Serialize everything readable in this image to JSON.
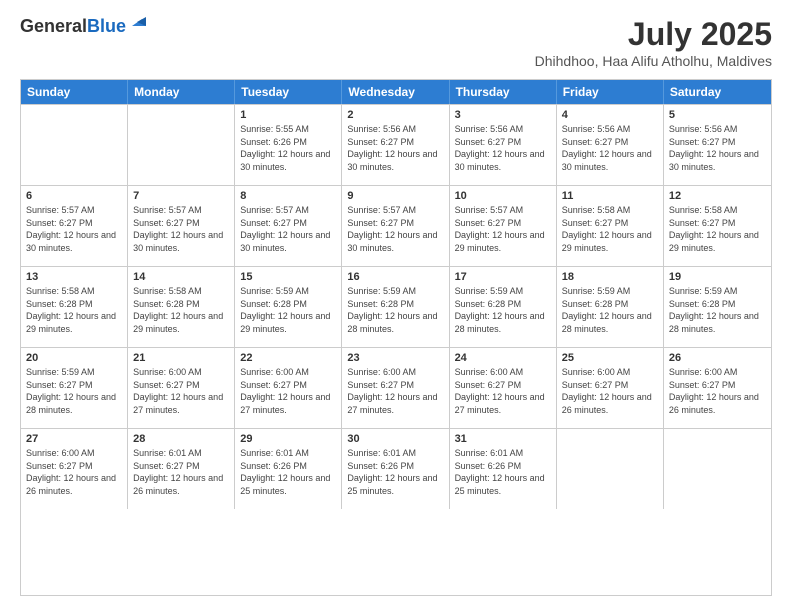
{
  "header": {
    "logo_general": "General",
    "logo_blue": "Blue",
    "month": "July 2025",
    "location": "Dhihdhoo, Haa Alifu Atholhu, Maldives"
  },
  "weekdays": [
    "Sunday",
    "Monday",
    "Tuesday",
    "Wednesday",
    "Thursday",
    "Friday",
    "Saturday"
  ],
  "weeks": [
    [
      {
        "day": "",
        "empty": true
      },
      {
        "day": "",
        "empty": true
      },
      {
        "day": "1",
        "sunrise": "Sunrise: 5:55 AM",
        "sunset": "Sunset: 6:26 PM",
        "daylight": "Daylight: 12 hours and 30 minutes."
      },
      {
        "day": "2",
        "sunrise": "Sunrise: 5:56 AM",
        "sunset": "Sunset: 6:27 PM",
        "daylight": "Daylight: 12 hours and 30 minutes."
      },
      {
        "day": "3",
        "sunrise": "Sunrise: 5:56 AM",
        "sunset": "Sunset: 6:27 PM",
        "daylight": "Daylight: 12 hours and 30 minutes."
      },
      {
        "day": "4",
        "sunrise": "Sunrise: 5:56 AM",
        "sunset": "Sunset: 6:27 PM",
        "daylight": "Daylight: 12 hours and 30 minutes."
      },
      {
        "day": "5",
        "sunrise": "Sunrise: 5:56 AM",
        "sunset": "Sunset: 6:27 PM",
        "daylight": "Daylight: 12 hours and 30 minutes."
      }
    ],
    [
      {
        "day": "6",
        "sunrise": "Sunrise: 5:57 AM",
        "sunset": "Sunset: 6:27 PM",
        "daylight": "Daylight: 12 hours and 30 minutes."
      },
      {
        "day": "7",
        "sunrise": "Sunrise: 5:57 AM",
        "sunset": "Sunset: 6:27 PM",
        "daylight": "Daylight: 12 hours and 30 minutes."
      },
      {
        "day": "8",
        "sunrise": "Sunrise: 5:57 AM",
        "sunset": "Sunset: 6:27 PM",
        "daylight": "Daylight: 12 hours and 30 minutes."
      },
      {
        "day": "9",
        "sunrise": "Sunrise: 5:57 AM",
        "sunset": "Sunset: 6:27 PM",
        "daylight": "Daylight: 12 hours and 30 minutes."
      },
      {
        "day": "10",
        "sunrise": "Sunrise: 5:57 AM",
        "sunset": "Sunset: 6:27 PM",
        "daylight": "Daylight: 12 hours and 29 minutes."
      },
      {
        "day": "11",
        "sunrise": "Sunrise: 5:58 AM",
        "sunset": "Sunset: 6:27 PM",
        "daylight": "Daylight: 12 hours and 29 minutes."
      },
      {
        "day": "12",
        "sunrise": "Sunrise: 5:58 AM",
        "sunset": "Sunset: 6:27 PM",
        "daylight": "Daylight: 12 hours and 29 minutes."
      }
    ],
    [
      {
        "day": "13",
        "sunrise": "Sunrise: 5:58 AM",
        "sunset": "Sunset: 6:28 PM",
        "daylight": "Daylight: 12 hours and 29 minutes."
      },
      {
        "day": "14",
        "sunrise": "Sunrise: 5:58 AM",
        "sunset": "Sunset: 6:28 PM",
        "daylight": "Daylight: 12 hours and 29 minutes."
      },
      {
        "day": "15",
        "sunrise": "Sunrise: 5:59 AM",
        "sunset": "Sunset: 6:28 PM",
        "daylight": "Daylight: 12 hours and 29 minutes."
      },
      {
        "day": "16",
        "sunrise": "Sunrise: 5:59 AM",
        "sunset": "Sunset: 6:28 PM",
        "daylight": "Daylight: 12 hours and 28 minutes."
      },
      {
        "day": "17",
        "sunrise": "Sunrise: 5:59 AM",
        "sunset": "Sunset: 6:28 PM",
        "daylight": "Daylight: 12 hours and 28 minutes."
      },
      {
        "day": "18",
        "sunrise": "Sunrise: 5:59 AM",
        "sunset": "Sunset: 6:28 PM",
        "daylight": "Daylight: 12 hours and 28 minutes."
      },
      {
        "day": "19",
        "sunrise": "Sunrise: 5:59 AM",
        "sunset": "Sunset: 6:28 PM",
        "daylight": "Daylight: 12 hours and 28 minutes."
      }
    ],
    [
      {
        "day": "20",
        "sunrise": "Sunrise: 5:59 AM",
        "sunset": "Sunset: 6:27 PM",
        "daylight": "Daylight: 12 hours and 28 minutes."
      },
      {
        "day": "21",
        "sunrise": "Sunrise: 6:00 AM",
        "sunset": "Sunset: 6:27 PM",
        "daylight": "Daylight: 12 hours and 27 minutes."
      },
      {
        "day": "22",
        "sunrise": "Sunrise: 6:00 AM",
        "sunset": "Sunset: 6:27 PM",
        "daylight": "Daylight: 12 hours and 27 minutes."
      },
      {
        "day": "23",
        "sunrise": "Sunrise: 6:00 AM",
        "sunset": "Sunset: 6:27 PM",
        "daylight": "Daylight: 12 hours and 27 minutes."
      },
      {
        "day": "24",
        "sunrise": "Sunrise: 6:00 AM",
        "sunset": "Sunset: 6:27 PM",
        "daylight": "Daylight: 12 hours and 27 minutes."
      },
      {
        "day": "25",
        "sunrise": "Sunrise: 6:00 AM",
        "sunset": "Sunset: 6:27 PM",
        "daylight": "Daylight: 12 hours and 26 minutes."
      },
      {
        "day": "26",
        "sunrise": "Sunrise: 6:00 AM",
        "sunset": "Sunset: 6:27 PM",
        "daylight": "Daylight: 12 hours and 26 minutes."
      }
    ],
    [
      {
        "day": "27",
        "sunrise": "Sunrise: 6:00 AM",
        "sunset": "Sunset: 6:27 PM",
        "daylight": "Daylight: 12 hours and 26 minutes."
      },
      {
        "day": "28",
        "sunrise": "Sunrise: 6:01 AM",
        "sunset": "Sunset: 6:27 PM",
        "daylight": "Daylight: 12 hours and 26 minutes."
      },
      {
        "day": "29",
        "sunrise": "Sunrise: 6:01 AM",
        "sunset": "Sunset: 6:26 PM",
        "daylight": "Daylight: 12 hours and 25 minutes."
      },
      {
        "day": "30",
        "sunrise": "Sunrise: 6:01 AM",
        "sunset": "Sunset: 6:26 PM",
        "daylight": "Daylight: 12 hours and 25 minutes."
      },
      {
        "day": "31",
        "sunrise": "Sunrise: 6:01 AM",
        "sunset": "Sunset: 6:26 PM",
        "daylight": "Daylight: 12 hours and 25 minutes."
      },
      {
        "day": "",
        "empty": true
      },
      {
        "day": "",
        "empty": true
      }
    ]
  ]
}
